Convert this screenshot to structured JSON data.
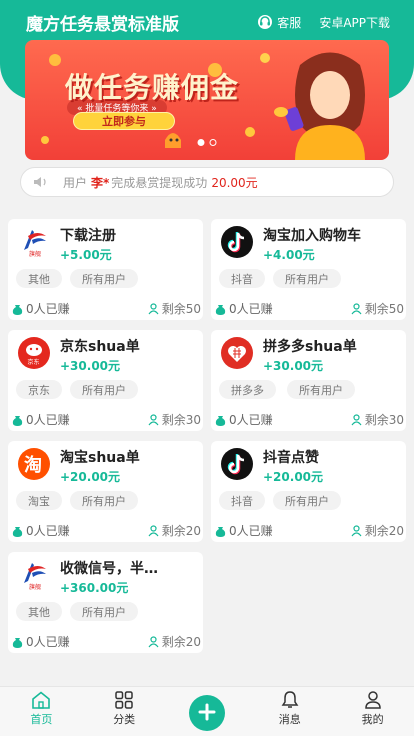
{
  "header": {
    "title": "魔方任务悬赏标准版",
    "service_label": "客服",
    "download_label": "安卓APP下载"
  },
  "banner": {
    "headline": "做任务赚佣金",
    "subline": "« 批量任务等你来 »",
    "cta": "立即参与",
    "slides_total": 2,
    "slide_active": 1
  },
  "notice": {
    "prefix": "用户",
    "user": "李*",
    "middle": "完成悬赏提现成功",
    "amount": "20.00元"
  },
  "tasks": [
    {
      "title": "下载注册",
      "price": "+5.00元",
      "tags": [
        "其他",
        "所有用户"
      ],
      "earned": "0人已赚",
      "remaining": "剩余50",
      "logo": "flag-logo-icon"
    },
    {
      "title": "淘宝加入购物车",
      "price": "+4.00元",
      "tags": [
        "抖音",
        "所有用户"
      ],
      "earned": "0人已赚",
      "remaining": "剩余50",
      "logo": "douyin-logo-icon"
    },
    {
      "title": "京东shua单",
      "price": "+30.00元",
      "tags": [
        "京东",
        "所有用户"
      ],
      "earned": "0人已赚",
      "remaining": "剩余30",
      "logo": "jd-logo-icon"
    },
    {
      "title": "拼多多shua单",
      "price": "+30.00元",
      "tags": [
        "拼多多",
        "所有用户"
      ],
      "earned": "0人已赚",
      "remaining": "剩余30",
      "logo": "pdd-logo-icon"
    },
    {
      "title": "淘宝shua单",
      "price": "+20.00元",
      "tags": [
        "淘宝",
        "所有用户"
      ],
      "earned": "0人已赚",
      "remaining": "剩余20",
      "logo": "taobao-logo-icon"
    },
    {
      "title": "抖音点赞",
      "price": "+20.00元",
      "tags": [
        "抖音",
        "所有用户"
      ],
      "earned": "0人已赚",
      "remaining": "剩余20",
      "logo": "douyin-logo-icon"
    },
    {
      "title": "收微信号，半…",
      "price": "+360.00元",
      "tags": [
        "其他",
        "所有用户"
      ],
      "earned": "0人已赚",
      "remaining": "剩余20",
      "logo": "flag-logo-icon"
    }
  ],
  "tabbar": {
    "home": "首页",
    "category": "分类",
    "messages": "消息",
    "mine": "我的"
  },
  "colors": {
    "brand": "#16b998",
    "alert": "#e0241c",
    "banner": "#f24038"
  }
}
